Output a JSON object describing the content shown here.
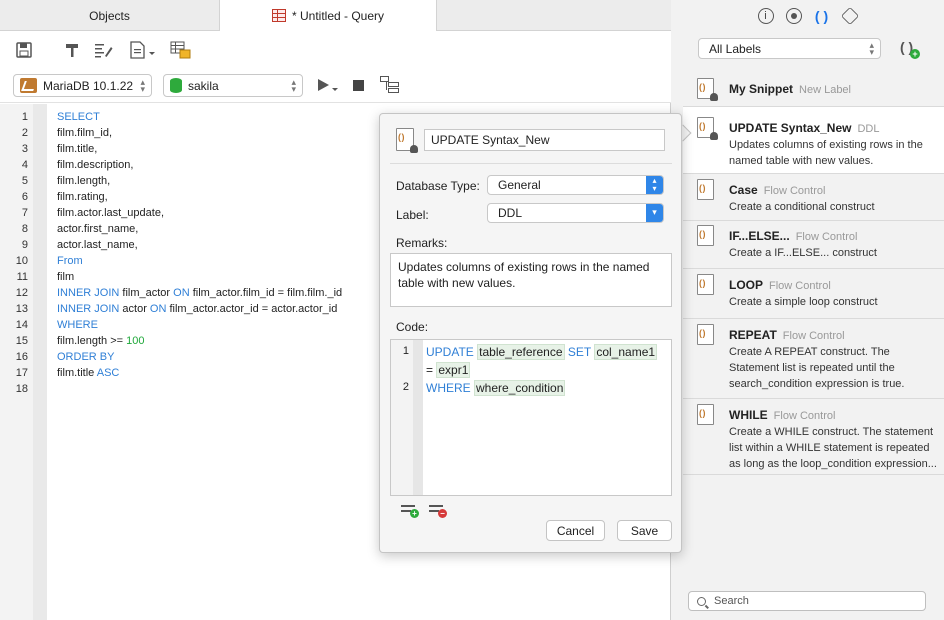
{
  "tabs": {
    "objects": "Objects",
    "query": "* Untitled - Query"
  },
  "toolbar": {
    "connection": "MariaDB 10.1.22",
    "schema": "sakila"
  },
  "editor": {
    "lines": [
      "1",
      "2",
      "3",
      "4",
      "5",
      "6",
      "7",
      "8",
      "9",
      "10",
      "11",
      "12",
      "13",
      "14",
      "15",
      "16",
      "17",
      "18"
    ],
    "sql": [
      [
        {
          "t": "SELECT",
          "k": "kw"
        }
      ],
      [
        {
          "t": "film.film_id,",
          "k": ""
        }
      ],
      [
        {
          "t": "film.title,",
          "k": ""
        }
      ],
      [
        {
          "t": "film.description,",
          "k": ""
        }
      ],
      [
        {
          "t": "film.length,",
          "k": ""
        }
      ],
      [
        {
          "t": "film.rating,",
          "k": ""
        }
      ],
      [
        {
          "t": "film.actor.last_update,",
          "k": ""
        }
      ],
      [
        {
          "t": "actor.first_name,",
          "k": ""
        }
      ],
      [
        {
          "t": "actor.last_name,",
          "k": ""
        }
      ],
      [
        {
          "t": "From",
          "k": "kw"
        }
      ],
      [
        {
          "t": "film",
          "k": ""
        }
      ],
      [
        {
          "t": "INNER JOIN",
          "k": "kw"
        },
        {
          "t": " film_actor ",
          "k": ""
        },
        {
          "t": "ON",
          "k": "kw"
        },
        {
          "t": " film_actor.film_id = film.film._id",
          "k": ""
        }
      ],
      [
        {
          "t": "INNER JOIN",
          "k": "kw"
        },
        {
          "t": " actor ",
          "k": ""
        },
        {
          "t": "ON",
          "k": "kw"
        },
        {
          "t": " film_actor.actor_id = actor.actor_id",
          "k": ""
        }
      ],
      [
        {
          "t": "WHERE",
          "k": "kw"
        }
      ],
      [
        {
          "t": "film.length >= ",
          "k": ""
        },
        {
          "t": "100",
          "k": "num"
        }
      ],
      [
        {
          "t": "ORDER BY",
          "k": "kw"
        }
      ],
      [
        {
          "t": "film.title ",
          "k": ""
        },
        {
          "t": "ASC",
          "k": "kw"
        }
      ],
      []
    ]
  },
  "snippet_panel": {
    "label_filter": "All Labels",
    "search_placeholder": "Search",
    "items": [
      {
        "title": "My Snippet",
        "label": "New Label",
        "desc": ""
      },
      {
        "title": "UPDATE Syntax_New",
        "label": "DDL",
        "desc": "Updates columns of existing rows in the named table with new values."
      },
      {
        "title": "Case",
        "label": "Flow Control",
        "desc": "Create a conditional construct"
      },
      {
        "title": "IF...ELSE...",
        "label": "Flow Control",
        "desc": "Create a IF...ELSE... construct"
      },
      {
        "title": "LOOP",
        "label": "Flow Control",
        "desc": "Create a simple loop construct"
      },
      {
        "title": "REPEAT",
        "label": "Flow Control",
        "desc": "Create A REPEAT construct. The Statement list is repeated until the search_condition expression is true."
      },
      {
        "title": "WHILE",
        "label": "Flow Control",
        "desc": "Create a WHILE construct. The statement list within a WHILE statement is repeated as long as the loop_condition expression..."
      }
    ]
  },
  "popup": {
    "name": "UPDATE Syntax_New",
    "db_type_label": "Database Type:",
    "db_type": "General",
    "label_label": "Label:",
    "label": "DDL",
    "remarks_label": "Remarks:",
    "remarks": "Updates columns of existing rows in the named table with new values.",
    "code_label": "Code:",
    "code_lines": [
      "1",
      "2"
    ],
    "code": {
      "update": "UPDATE",
      "table_reference": "table_reference",
      "set": "SET",
      "col_name1": "col_name1",
      "eq": "=",
      "expr1": "expr1",
      "where": "WHERE",
      "where_condition": "where_condition"
    },
    "cancel": "Cancel",
    "save": "Save"
  }
}
